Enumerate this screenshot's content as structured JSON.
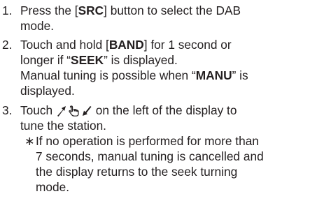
{
  "steps": [
    {
      "number": "1.",
      "lines": [
        {
          "pre": "Press the [",
          "bold": "SRC",
          "post": "] button to select the DAB"
        },
        {
          "text": "mode."
        }
      ]
    },
    {
      "number": "2.",
      "lines": [
        {
          "pre": "Touch and hold [",
          "bold": "BAND",
          "post": "] for 1 second or"
        },
        {
          "pre": "longer if “",
          "bold": "SEEK",
          "post": "” is displayed."
        },
        {
          "pre": "Manual tuning is possible when “",
          "bold": "MANU",
          "post": "” is"
        },
        {
          "text": "displayed."
        }
      ]
    },
    {
      "number": "3.",
      "lines": [
        {
          "post": " on the left of the display to",
          "pre": "Touch "
        },
        {
          "text": "tune the station."
        }
      ],
      "icons": [
        "arrow-up-icon",
        "hand-touch-icon",
        "arrow-down-icon"
      ],
      "note": {
        "marker": "∗",
        "lines": [
          "If no operation is performed for more than",
          "7 seconds, manual tuning is cancelled and",
          "the display returns to the seek turning",
          "mode."
        ]
      }
    }
  ]
}
